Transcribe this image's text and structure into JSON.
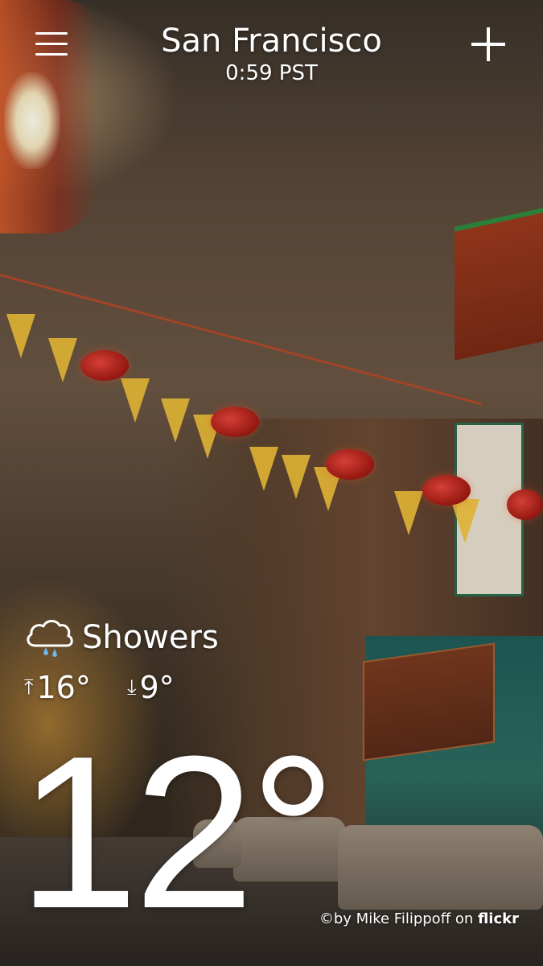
{
  "header": {
    "city": "San Francisco",
    "time": "0:59 PST"
  },
  "icons": {
    "menu": "hamburger-menu-icon",
    "add": "plus-icon",
    "condition": "cloud-rain-icon",
    "high": "arrow-up-icon",
    "low": "arrow-down-icon"
  },
  "weather": {
    "condition": "Showers",
    "high": "16°",
    "low": "9°",
    "current": "12°"
  },
  "photo_credit": {
    "prefix": "©by Mike Filippoff on ",
    "brand": "flickr"
  },
  "colors": {
    "text": "#ffffff",
    "rain_drop": "#6fb7e6"
  }
}
